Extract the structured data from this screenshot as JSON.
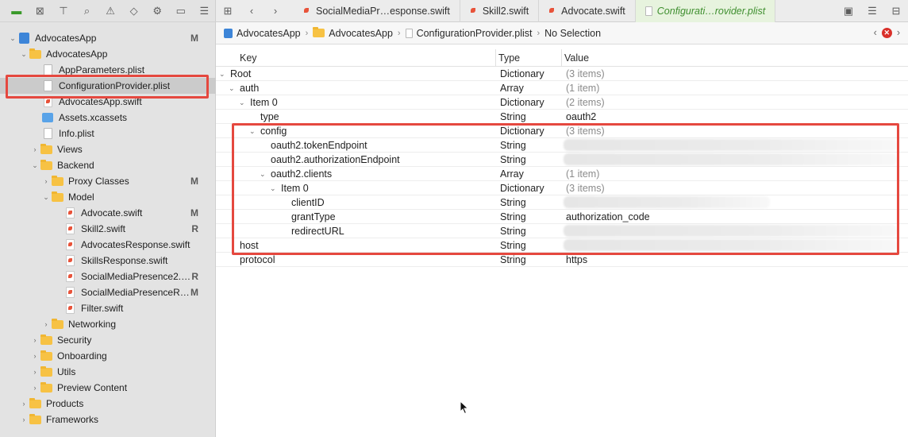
{
  "tabs": [
    {
      "label": "SocialMediaPr…esponse.swift"
    },
    {
      "label": "Skill2.swift"
    },
    {
      "label": "Advocate.swift"
    },
    {
      "label": "Configurati…rovider.plist"
    }
  ],
  "jumpbar": {
    "crumb1": "AdvocatesApp",
    "crumb2": "AdvocatesApp",
    "crumb3": "ConfigurationProvider.plist",
    "crumb4": "No Selection"
  },
  "navigator": {
    "items": [
      {
        "label": "AdvocatesApp",
        "status": "M"
      },
      {
        "label": "AdvocatesApp",
        "status": ""
      },
      {
        "label": "AppParameters.plist",
        "status": ""
      },
      {
        "label": "ConfigurationProvider.plist",
        "status": ""
      },
      {
        "label": "AdvocatesApp.swift",
        "status": ""
      },
      {
        "label": "Assets.xcassets",
        "status": ""
      },
      {
        "label": "Info.plist",
        "status": ""
      },
      {
        "label": "Views",
        "status": ""
      },
      {
        "label": "Backend",
        "status": ""
      },
      {
        "label": "Proxy Classes",
        "status": "M"
      },
      {
        "label": "Model",
        "status": ""
      },
      {
        "label": "Advocate.swift",
        "status": "M"
      },
      {
        "label": "Skill2.swift",
        "status": "R"
      },
      {
        "label": "AdvocatesResponse.swift",
        "status": ""
      },
      {
        "label": "SkillsResponse.swift",
        "status": ""
      },
      {
        "label": "SocialMediaPresence2.…",
        "status": "R"
      },
      {
        "label": "SocialMediaPresenceR…",
        "status": "M"
      },
      {
        "label": "Filter.swift",
        "status": ""
      },
      {
        "label": "Networking",
        "status": ""
      },
      {
        "label": "Security",
        "status": ""
      },
      {
        "label": "Onboarding",
        "status": ""
      },
      {
        "label": "Utils",
        "status": ""
      },
      {
        "label": "Preview Content",
        "status": ""
      },
      {
        "label": "Products",
        "status": ""
      },
      {
        "label": "Frameworks",
        "status": ""
      }
    ]
  },
  "plist": {
    "headers": {
      "key": "Key",
      "type": "Type",
      "value": "Value"
    },
    "rows": [
      {
        "key": "Root",
        "type": "Dictionary",
        "value": "(3 items)"
      },
      {
        "key": "auth",
        "type": "Array",
        "value": "(1 item)"
      },
      {
        "key": "Item 0",
        "type": "Dictionary",
        "value": "(2 items)"
      },
      {
        "key": "type",
        "type": "String",
        "value": "oauth2"
      },
      {
        "key": "config",
        "type": "Dictionary",
        "value": "(3 items)"
      },
      {
        "key": "oauth2.tokenEndpoint",
        "type": "String",
        "value": ""
      },
      {
        "key": "oauth2.authorizationEndpoint",
        "type": "String",
        "value": ""
      },
      {
        "key": "oauth2.clients",
        "type": "Array",
        "value": "(1 item)"
      },
      {
        "key": "Item 0",
        "type": "Dictionary",
        "value": "(3 items)"
      },
      {
        "key": "clientID",
        "type": "String",
        "value": ""
      },
      {
        "key": "grantType",
        "type": "String",
        "value": "authorization_code"
      },
      {
        "key": "redirectURL",
        "type": "String",
        "value": ""
      },
      {
        "key": "host",
        "type": "String",
        "value": ""
      },
      {
        "key": "protocol",
        "type": "String",
        "value": "https"
      }
    ]
  },
  "colors": {
    "highlight": "#e5483f",
    "active_tab": "#3f8f2f"
  }
}
